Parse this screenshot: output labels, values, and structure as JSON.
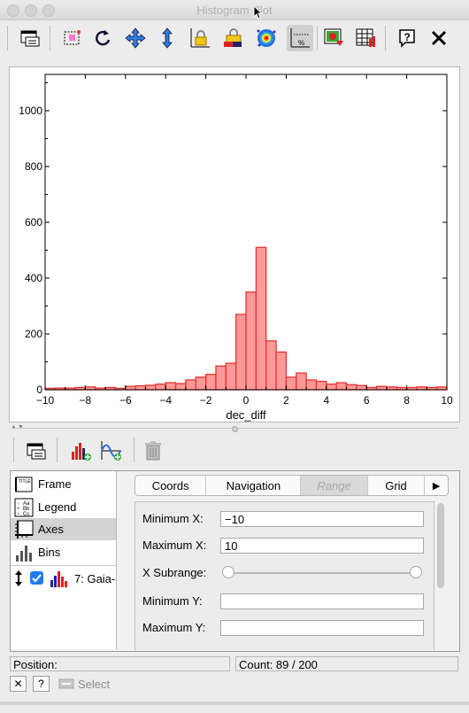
{
  "window": {
    "title": "Histogram Plot"
  },
  "toolbar": {
    "items": [
      "window-icon",
      "zoom-box-icon",
      "replot-icon",
      "pan-icon",
      "vertical-zoom-icon",
      "lock-icon",
      "multi-lock-icon",
      "density-icon",
      "weights-icon",
      "export-image-icon",
      "table-export-icon",
      "help-icon",
      "close-icon"
    ]
  },
  "chart_data": {
    "type": "bar",
    "xlabel": "dec_diff",
    "ylabel": "",
    "xlim": [
      -10,
      10
    ],
    "ylim": [
      0,
      1130
    ],
    "x_ticks": [
      -10,
      -8,
      -6,
      -4,
      -2,
      0,
      2,
      4,
      6,
      8,
      10
    ],
    "y_ticks": [
      0,
      200,
      400,
      600,
      800,
      1000
    ],
    "bin_width": 0.5,
    "bin_starts": [
      -10,
      -9.5,
      -9,
      -8.5,
      -8,
      -7.5,
      -7,
      -6.5,
      -6,
      -5.5,
      -5,
      -4.5,
      -4,
      -3.5,
      -3,
      -2.5,
      -2,
      -1.5,
      -1,
      -0.5,
      0,
      0.5,
      1,
      1.5,
      2,
      2.5,
      3,
      3.5,
      4,
      4.5,
      5,
      5.5,
      6,
      6.5,
      7,
      7.5,
      8,
      8.5,
      9,
      9.5
    ],
    "values": [
      5,
      6,
      6,
      8,
      10,
      6,
      8,
      5,
      12,
      14,
      16,
      20,
      25,
      22,
      35,
      45,
      55,
      85,
      95,
      270,
      350,
      510,
      175,
      135,
      45,
      60,
      35,
      30,
      20,
      25,
      18,
      15,
      8,
      12,
      10,
      8,
      8,
      10,
      8,
      10
    ],
    "bar_color": "#ff9999",
    "bar_edge": "#e8332e",
    "grid": false
  },
  "resize_handles": {
    "up": "▲",
    "down": "▼"
  },
  "panel_toolbar": {
    "items": [
      "window-icon",
      "add-histogram-icon",
      "add-function-icon",
      "delete-icon"
    ]
  },
  "sidebar": {
    "items": [
      {
        "label": "Frame",
        "icon": "frame-icon"
      },
      {
        "label": "Legend",
        "icon": "legend-icon"
      },
      {
        "label": "Axes",
        "icon": "axes-icon"
      },
      {
        "label": "Bins",
        "icon": "bins-icon"
      }
    ],
    "layer": {
      "label": "7: Gaia-",
      "checked": true
    }
  },
  "tabs": [
    "Coords",
    "Navigation",
    "Range",
    "Grid"
  ],
  "tabs_more": "▶",
  "form": {
    "min_x_label": "Minimum X:",
    "min_x_value": "−10",
    "max_x_label": "Maximum X:",
    "max_x_value": "10",
    "subrange_label": "X Subrange:",
    "min_y_label": "Minimum Y:",
    "min_y_value": "",
    "max_y_label": "Maximum Y:",
    "max_y_value": ""
  },
  "status": {
    "position_label": "Position:",
    "count_text": "Count: 89 / 200"
  },
  "bottom": {
    "close": "✕",
    "help": "?",
    "select_label": "Select"
  }
}
